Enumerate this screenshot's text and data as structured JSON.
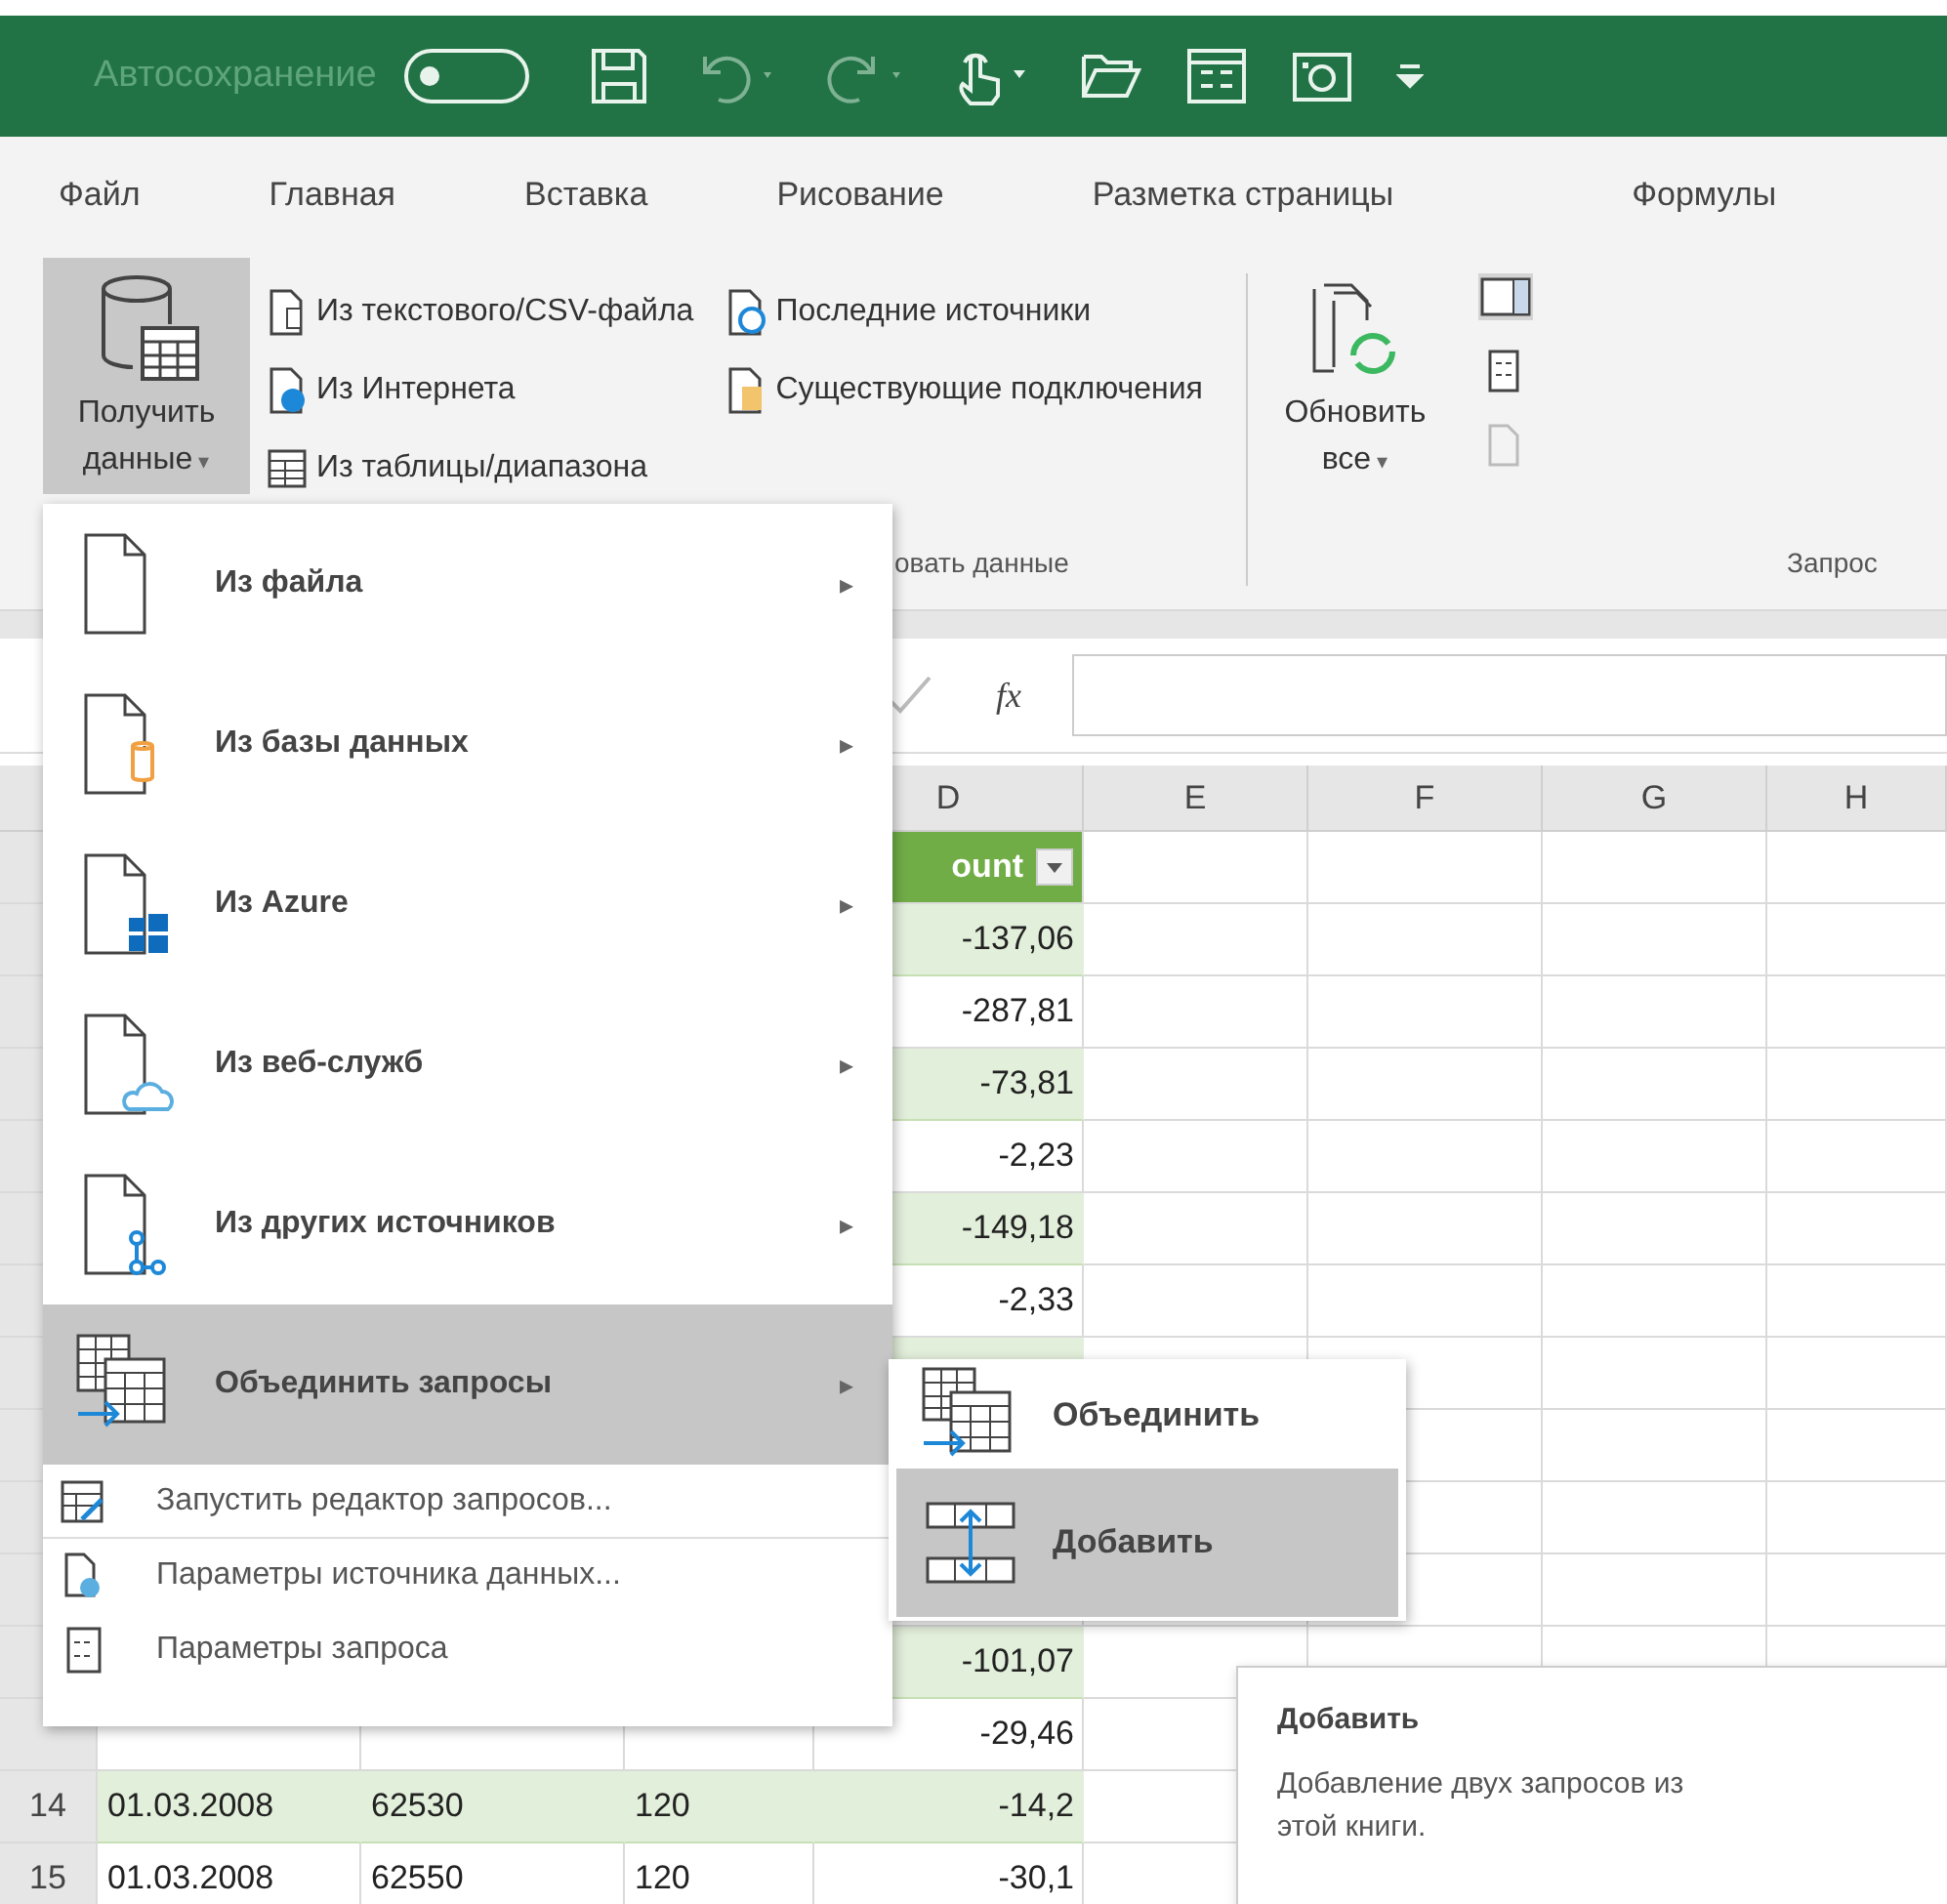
{
  "title_bar": {
    "autosave_label": "Автосохранение",
    "autosave_on": false
  },
  "tabs": [
    "Файл",
    "Главная",
    "Вставка",
    "Рисование",
    "Разметка страницы",
    "Формулы"
  ],
  "ribbon": {
    "get_data": {
      "lines": [
        "Получить",
        "данные"
      ],
      "caret": "▾",
      "expanded": true
    },
    "sources_left": [
      {
        "kind": "text",
        "label": "Из текстового/CSV-файла"
      },
      {
        "kind": "web",
        "label": "Из Интернета"
      },
      {
        "kind": "table",
        "label": "Из таблицы/диапазона"
      }
    ],
    "sources_right": [
      {
        "kind": "recent",
        "label": "Последние источники"
      },
      {
        "kind": "existing",
        "label": "Существующие подключения"
      }
    ],
    "group_label": "овать данные",
    "refresh": {
      "lines": [
        "Обновить",
        "все"
      ],
      "caret": "▾"
    },
    "queries_label": "Запрос"
  },
  "formula_bar": {
    "fx": "fx"
  },
  "columns": [
    "D",
    "E",
    "F",
    "G",
    "H"
  ],
  "table_header": {
    "d": "ount"
  },
  "rows": [
    {
      "d": "-137,06"
    },
    {
      "d": "-287,81"
    },
    {
      "d": "-73,81"
    },
    {
      "d": "-2,23"
    },
    {
      "d": "-149,18"
    },
    {
      "d": "-2,33"
    },
    {},
    {},
    {},
    {},
    {
      "d": "-101,07"
    },
    {
      "d": "-29,46"
    },
    {
      "number": "14",
      "a": "01.03.2008",
      "b": "62530",
      "c": "120",
      "d": "-14,2"
    },
    {
      "number": "15",
      "a": "01.03.2008",
      "b": "62550",
      "c": "120",
      "d": "-30,1"
    }
  ],
  "menu": {
    "items": [
      {
        "kind": "file",
        "label": "Из файла",
        "arrow": "▸",
        "selected": false
      },
      {
        "kind": "database",
        "label": "Из базы данных",
        "arrow": "▸",
        "selected": false
      },
      {
        "kind": "azure",
        "label": "Из Azure",
        "arrow": "▸",
        "selected": false
      },
      {
        "kind": "webservice",
        "label": "Из веб-служб",
        "arrow": "▸",
        "selected": false
      },
      {
        "kind": "other",
        "label": "Из других источников",
        "arrow": "▸",
        "selected": false
      },
      {
        "kind": "combine",
        "label": "Объединить запросы",
        "arrow": "▸",
        "selected": true
      },
      {
        "kind": "editor",
        "label": "Запустить редактор запросов...",
        "separator_after": true,
        "selected": false
      },
      {
        "kind": "source-settings",
        "label": "Параметры источника данных...",
        "separator_after": false,
        "selected": false
      },
      {
        "kind": "query-settings",
        "label": "Параметры запроса",
        "separator_after": false,
        "selected": false
      }
    ]
  },
  "submenu": {
    "items": [
      {
        "kind": "merge",
        "label": "Объединить",
        "selected": false
      },
      {
        "kind": "append",
        "label": "Добавить",
        "selected": true
      }
    ]
  },
  "tooltip": {
    "title": "Добавить",
    "text": "Добавление двух запросов из этой книги."
  }
}
